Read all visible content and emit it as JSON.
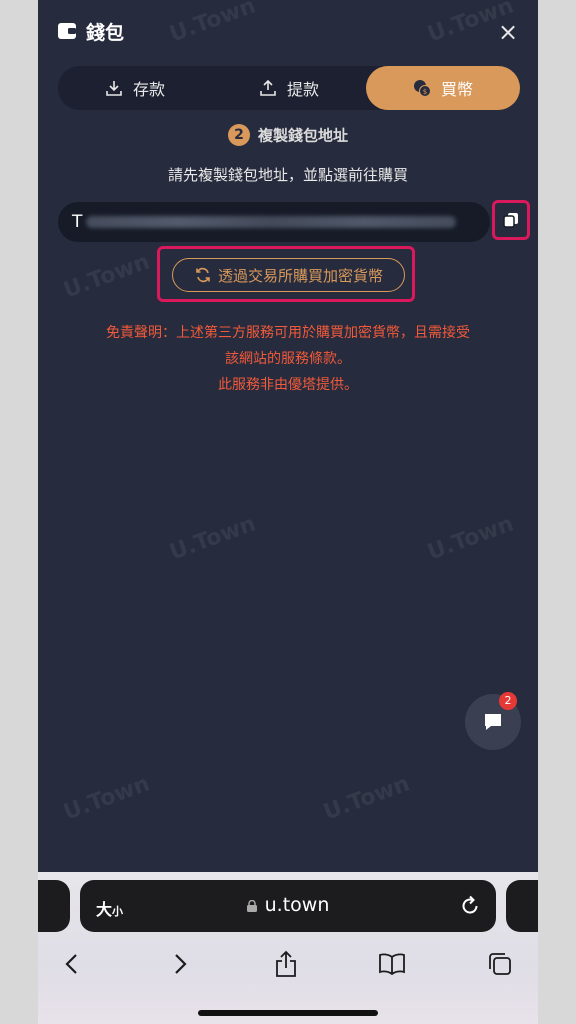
{
  "header": {
    "title": "錢包",
    "close_label": "×"
  },
  "tabs": [
    {
      "label": "存款",
      "icon": "download-icon",
      "active": false
    },
    {
      "label": "提款",
      "icon": "upload-icon",
      "active": false
    },
    {
      "label": "買幣",
      "icon": "coins-icon",
      "active": true
    }
  ],
  "step": {
    "number": "2",
    "label": "複製錢包地址"
  },
  "instruction": "請先複製錢包地址，並點選前往購買",
  "address": {
    "prefix": "T"
  },
  "exchange_button": {
    "label": "透過交易所購買加密貨幣"
  },
  "disclaimer": {
    "line1": "免責聲明：上述第三方服務可用於購買加密貨幣，且需接受",
    "line2": "該網站的服務條款。",
    "line3": "此服務非由優塔提供。"
  },
  "watermark": "U.Town",
  "chat": {
    "badge": "2"
  },
  "browser": {
    "text_size_label": "大",
    "text_size_small": "小",
    "url": "u.town"
  },
  "colors": {
    "accent": "#d9995b",
    "background": "#262b3d",
    "highlight": "#d9195b",
    "warning": "#f15a3a"
  }
}
